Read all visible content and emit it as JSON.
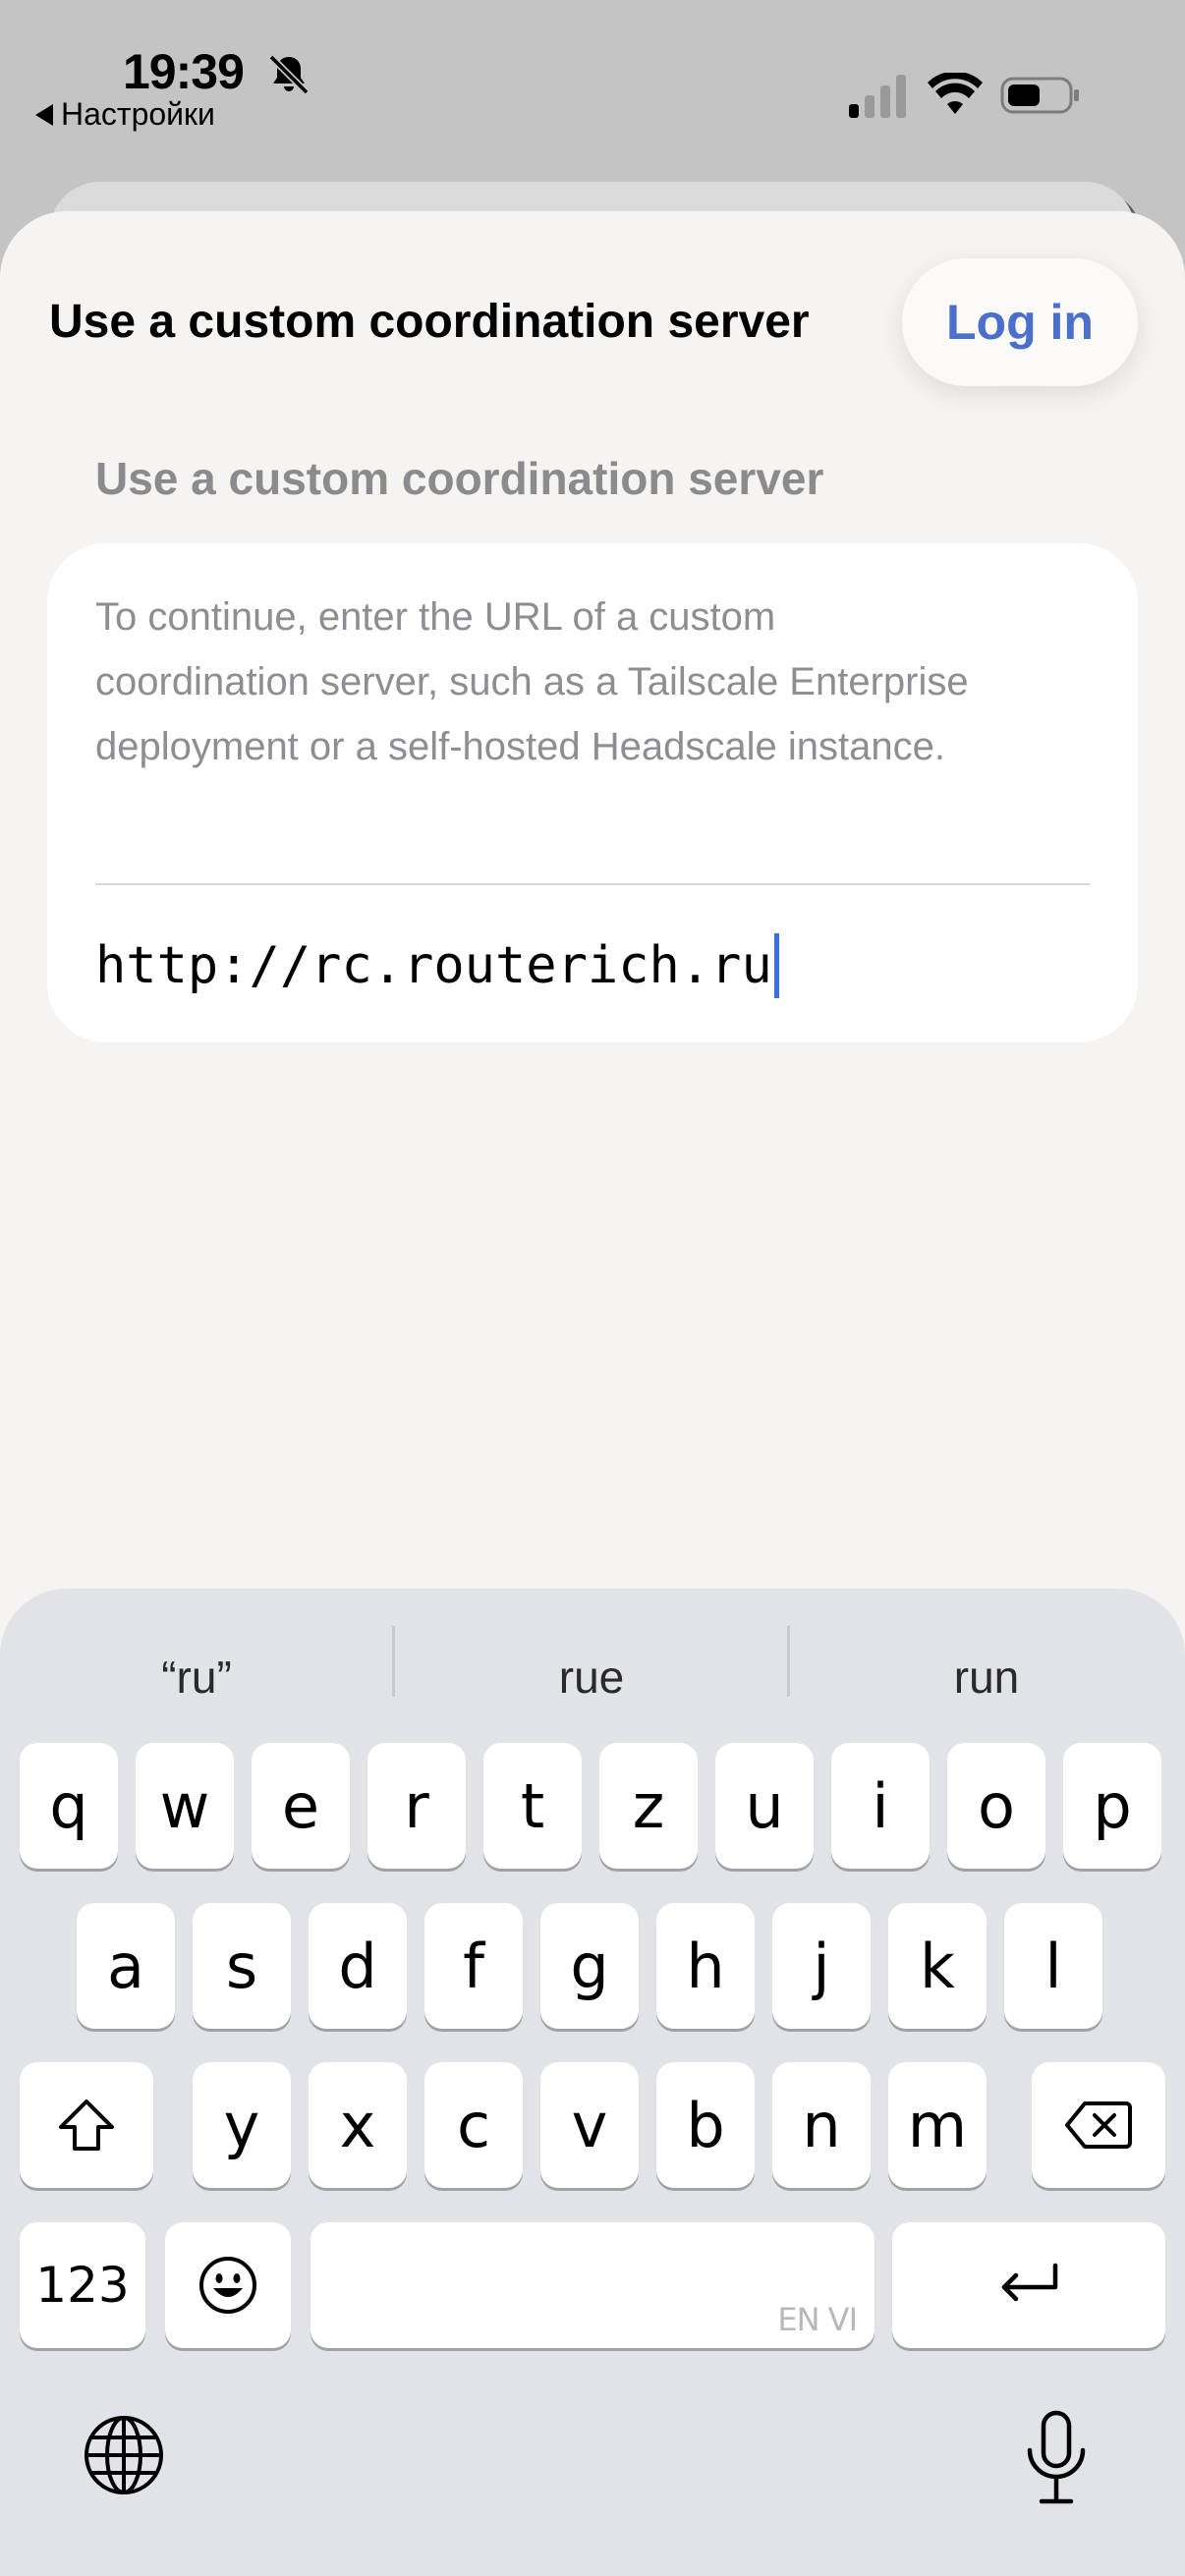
{
  "status_bar": {
    "time": "19:39",
    "back_label": "Настройки",
    "icons": [
      "bell-slash-icon",
      "cellular-signal-icon",
      "wifi-icon",
      "battery-icon"
    ]
  },
  "nav": {
    "title": "Use a custom coordination server",
    "login_label": "Log in",
    "accent_color": "#4a6fcc"
  },
  "form": {
    "section_header": "Use a custom coordination server",
    "description": "To continue, enter the URL of a custom coordination server, such as a Tailscale Enterprise deployment or a self-hosted Headscale instance.",
    "url_value": "http://rc.routerich.ru"
  },
  "keyboard": {
    "suggestions": [
      "“ru”",
      "rue",
      "run"
    ],
    "row1": [
      "q",
      "w",
      "e",
      "r",
      "t",
      "z",
      "u",
      "i",
      "o",
      "p"
    ],
    "row2": [
      "a",
      "s",
      "d",
      "f",
      "g",
      "h",
      "j",
      "k",
      "l"
    ],
    "row3": [
      "y",
      "x",
      "c",
      "v",
      "b",
      "n",
      "m"
    ],
    "numbers_label": "123",
    "space_hint": "EN VI",
    "icons": [
      "shift-icon",
      "backspace-icon",
      "emoji-icon",
      "return-icon",
      "globe-icon",
      "microphone-icon"
    ]
  }
}
